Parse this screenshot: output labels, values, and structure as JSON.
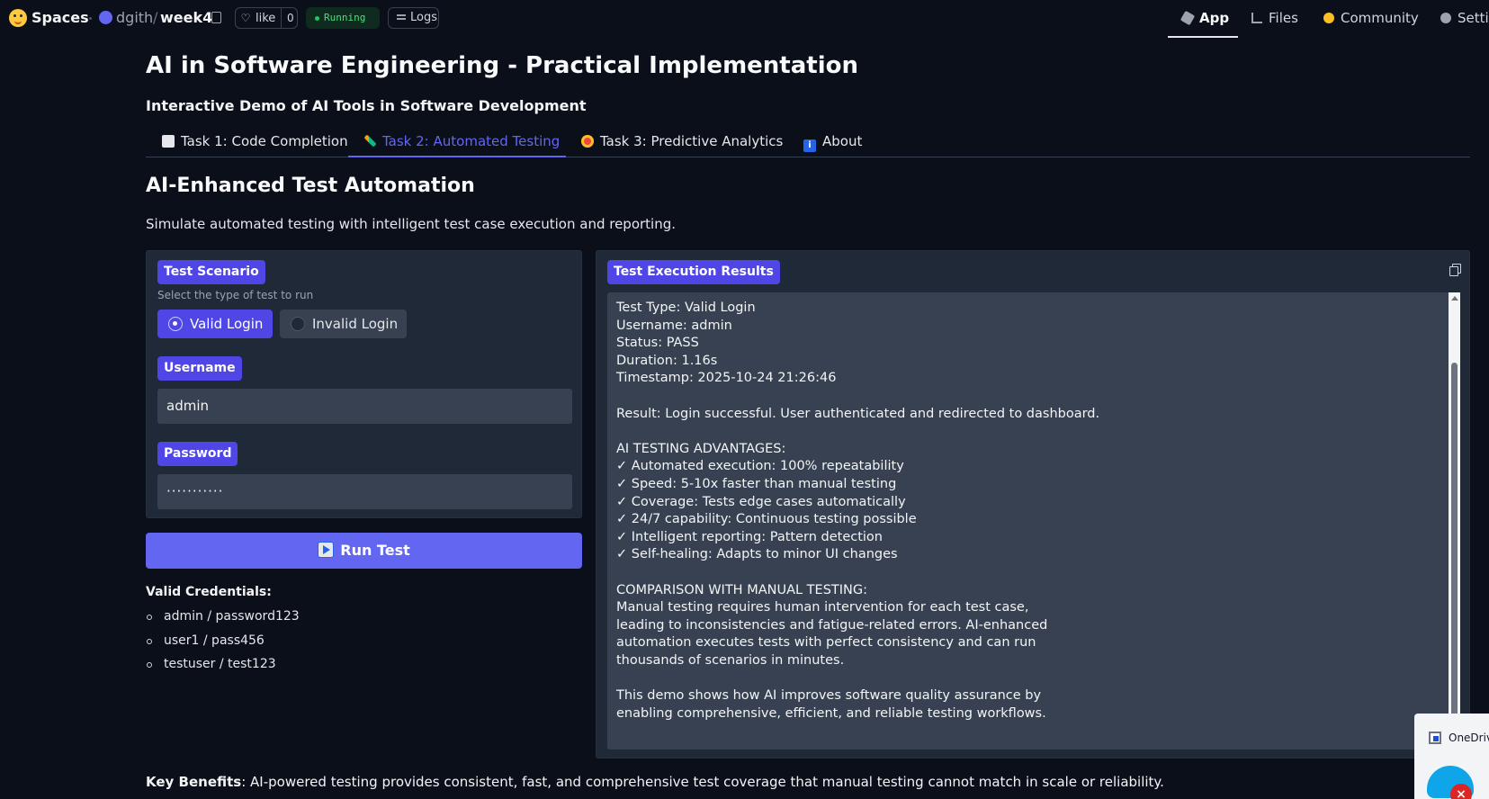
{
  "topbar": {
    "spaces_label": "Spaces",
    "owner": "dgith",
    "separator": "/",
    "repo": "week4",
    "like_label": "like",
    "like_count": "0",
    "status": "Running",
    "logs_label": "Logs",
    "nav": {
      "app": "App",
      "files": "Files",
      "community": "Community",
      "settings": "Setti"
    }
  },
  "page": {
    "title": "AI in Software Engineering - Practical Implementation",
    "subtitle": "Interactive Demo of AI Tools in Software Development"
  },
  "tabs": [
    {
      "label": "Task 1: Code Completion"
    },
    {
      "label": "Task 2: Automated Testing"
    },
    {
      "label": "Task 3: Predictive Analytics"
    },
    {
      "label": "About"
    }
  ],
  "active_tab": "Task 2: Automated Testing",
  "section": {
    "title": "AI-Enhanced Test Automation",
    "description": "Simulate automated testing with intelligent test case execution and reporting."
  },
  "form": {
    "scenario_label": "Test Scenario",
    "scenario_info": "Select the type of test to run",
    "options": [
      "Valid Login",
      "Invalid Login"
    ],
    "selected_option": "Valid Login",
    "username_label": "Username",
    "username_value": "admin",
    "password_label": "Password",
    "password_value": "···········",
    "run_button": "Run Test"
  },
  "credentials": {
    "title": "Valid Credentials:",
    "items": [
      "admin / password123",
      "user1 / pass456",
      "testuser / test123"
    ]
  },
  "results": {
    "label": "Test Execution Results",
    "lines": [
      "Test Type: Valid Login",
      "Username: admin",
      "Status: PASS",
      "Duration: 1.16s",
      "Timestamp: 2025-10-24 21:26:46",
      "",
      "Result: Login successful. User authenticated and redirected to dashboard.",
      "",
      "AI TESTING ADVANTAGES:",
      "✓ Automated execution: 100% repeatability",
      "✓ Speed: 5-10x faster than manual testing",
      "✓ Coverage: Tests edge cases automatically",
      "✓ 24/7 capability: Continuous testing possible",
      "✓ Intelligent reporting: Pattern detection",
      "✓ Self-healing: Adapts to minor UI changes",
      "",
      "COMPARISON WITH MANUAL TESTING:",
      "Manual testing requires human intervention for each test case,",
      "leading to inconsistencies and fatigue-related errors. AI-enhanced",
      "automation executes tests with perfect consistency and can run",
      "thousands of scenarios in minutes.",
      "",
      "This demo shows how AI improves software quality assurance by",
      "enabling comprehensive, efficient, and reliable testing workflows."
    ]
  },
  "footer": {
    "key_benefits_label": "Key Benefits",
    "key_benefits_text": ": AI-powered testing provides consistent, fast, and comprehensive test coverage that manual testing cannot match in scale or reliability."
  },
  "popup": {
    "label": "OneDriv"
  },
  "colors": {
    "accent": "#6366f1",
    "badge": "#4f46e5",
    "background": "#0b0f19",
    "panel": "#1f2937",
    "input": "#374151"
  }
}
